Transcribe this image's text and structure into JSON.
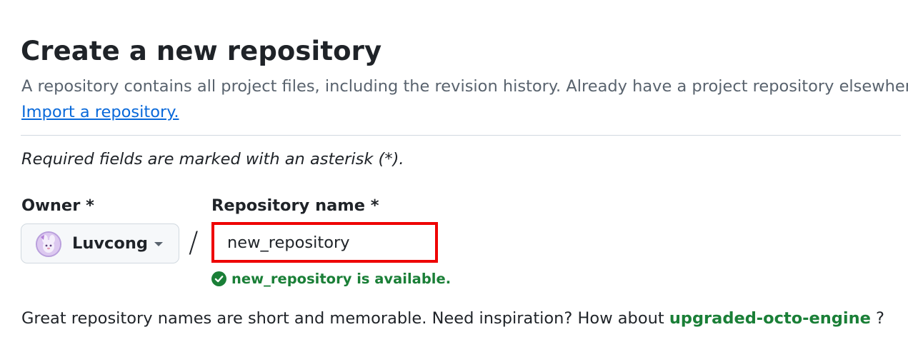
{
  "header": {
    "title": "Create a new repository",
    "subtitle": "A repository contains all project files, including the revision history. Already have a project repository elsewhere?",
    "import_link": "Import a repository."
  },
  "form": {
    "required_note": "Required fields are marked with an asterisk (*).",
    "owner": {
      "label": "Owner *",
      "selected": "Luvcong",
      "avatar_icon": "user-avatar",
      "dropdown_icon": "caret-down-icon"
    },
    "separator": "/",
    "repository_name": {
      "label": "Repository name *",
      "value": "new_repository",
      "highlight_color": "#ee0000"
    },
    "availability": {
      "icon": "check-circle-icon",
      "text": "new_repository is available.",
      "color": "#1a7f37"
    },
    "suggestion": {
      "prefix": "Great repository names are short and memorable. Need inspiration? How about",
      "name": "upgraded-octo-engine",
      "suffix": " ?"
    }
  },
  "colors": {
    "link": "#0969da",
    "success": "#1a7f37",
    "muted_text": "#59636e",
    "border": "#d1d9e0"
  }
}
